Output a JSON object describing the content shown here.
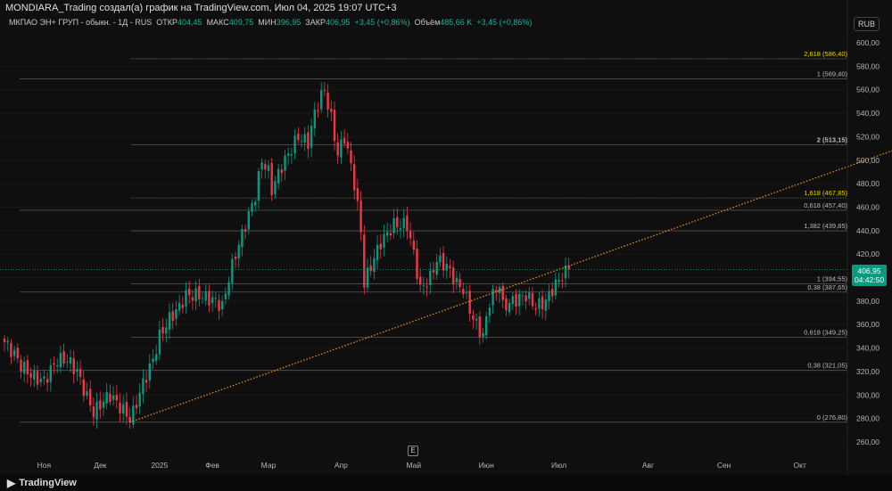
{
  "header": {
    "title": "MONDIARA_Trading создал(а) график на TradingView.com, Июл 04, 2025 19:07 UTC+3"
  },
  "legend": {
    "symbol": "МКПАО ЭН+ ГРУП - обыкн. - 1Д - RUS",
    "open_label": "ОТКР",
    "open": "404,45",
    "high_label": "МАКС",
    "high": "409,75",
    "low_label": "МИН",
    "low": "396,95",
    "close_label": "ЗАКР",
    "close": "406,95",
    "change": "+3,45 (+0,86%)",
    "volume_label": "Объём",
    "volume": "485,66 K",
    "vol_change": "+3,45 (+0,86%)"
  },
  "currency": "RUB",
  "price_tag": {
    "price": "406,95",
    "countdown": "04:42:50"
  },
  "earnings_marker": "E",
  "footer": {
    "brand": "TradingView"
  },
  "colors": {
    "up": "#089981",
    "down": "#f23645",
    "fib_hi": "#f5d000",
    "trend": "#f7931a"
  },
  "chart_data": {
    "type": "candlestick",
    "ylim": [
      260,
      600
    ],
    "y_ticks": [
      "260,00",
      "280,00",
      "300,00",
      "320,00",
      "340,00",
      "360,00",
      "380,00",
      "400,00",
      "420,00",
      "440,00",
      "460,00",
      "480,00",
      "500,00",
      "520,00",
      "540,00",
      "560,00",
      "580,00",
      "600,00"
    ],
    "x_ticks": [
      [
        "Ноя",
        12
      ],
      [
        "Дек",
        29
      ],
      [
        "2025",
        47
      ],
      [
        "Фев",
        63
      ],
      [
        "Мар",
        80
      ],
      [
        "Апр",
        102
      ],
      [
        "Май",
        124
      ],
      [
        "Июн",
        146
      ],
      [
        "Июл",
        168
      ],
      [
        "Авг",
        195
      ],
      [
        "Сен",
        218
      ],
      [
        "Окт",
        241
      ]
    ],
    "close_keypoints": [
      [
        0,
        345
      ],
      [
        3,
        335
      ],
      [
        5,
        325
      ],
      [
        9,
        315
      ],
      [
        12,
        312
      ],
      [
        16,
        330
      ],
      [
        19,
        330
      ],
      [
        22,
        320
      ],
      [
        24,
        305
      ],
      [
        27,
        285
      ],
      [
        30,
        295
      ],
      [
        32,
        300
      ],
      [
        35,
        290
      ],
      [
        38,
        280
      ],
      [
        39,
        285
      ],
      [
        42,
        310
      ],
      [
        45,
        330
      ],
      [
        47,
        350
      ],
      [
        50,
        365
      ],
      [
        53,
        375
      ],
      [
        55,
        385
      ],
      [
        59,
        385
      ],
      [
        64,
        380
      ],
      [
        66,
        375
      ],
      [
        68,
        400
      ],
      [
        70,
        420
      ],
      [
        73,
        445
      ],
      [
        76,
        470
      ],
      [
        78,
        500
      ],
      [
        80,
        490
      ],
      [
        81,
        475
      ],
      [
        84,
        495
      ],
      [
        86,
        505
      ],
      [
        89,
        520
      ],
      [
        92,
        515
      ],
      [
        94,
        540
      ],
      [
        96,
        555
      ],
      [
        97,
        560
      ],
      [
        99,
        535
      ],
      [
        101,
        505
      ],
      [
        103,
        520
      ],
      [
        105,
        495
      ],
      [
        106,
        480
      ],
      [
        108,
        440
      ],
      [
        109,
        395
      ],
      [
        111,
        410
      ],
      [
        114,
        430
      ],
      [
        118,
        445
      ],
      [
        122,
        445
      ],
      [
        124,
        420
      ],
      [
        126,
        390
      ],
      [
        129,
        400
      ],
      [
        131,
        415
      ],
      [
        134,
        410
      ],
      [
        137,
        395
      ],
      [
        139,
        390
      ],
      [
        142,
        365
      ],
      [
        145,
        350
      ],
      [
        147,
        380
      ],
      [
        150,
        395
      ],
      [
        151,
        375
      ],
      [
        154,
        380
      ],
      [
        158,
        385
      ],
      [
        161,
        375
      ],
      [
        164,
        380
      ],
      [
        166,
        390
      ],
      [
        169,
        402
      ],
      [
        171,
        406.95
      ]
    ],
    "fib_levels": [
      {
        "label": "2,618 (586,40)",
        "price": 586.4,
        "highlight": true,
        "long": false
      },
      {
        "label": "1 (569,40)",
        "price": 569.4,
        "highlight": false,
        "long": true
      },
      {
        "label": "2 (513,15)",
        "price": 513.15,
        "highlight": false,
        "bold": true,
        "long": false
      },
      {
        "label": "1,618 (467,85)",
        "price": 467.85,
        "highlight": true,
        "long": false
      },
      {
        "label": "0,618 (457,40)",
        "price": 457.4,
        "highlight": false,
        "long": true
      },
      {
        "label": "1,382 (439,85)",
        "price": 439.85,
        "highlight": false,
        "long": false
      },
      {
        "label": "1 (394,55)",
        "price": 394.55,
        "highlight": false,
        "long": false
      },
      {
        "label": "0,38 (387,65)",
        "price": 387.65,
        "highlight": false,
        "long": true
      },
      {
        "label": "0,618 (349,25)",
        "price": 349.25,
        "highlight": false,
        "long": false
      },
      {
        "label": "0,38 (321,05)",
        "price": 321.05,
        "highlight": false,
        "long": true
      },
      {
        "label": "0 (276,80)",
        "price": 276.8,
        "highlight": false,
        "long": true
      }
    ],
    "trendline": {
      "from": [
        38,
        276.8
      ],
      "to_price_at_right": 508
    }
  }
}
